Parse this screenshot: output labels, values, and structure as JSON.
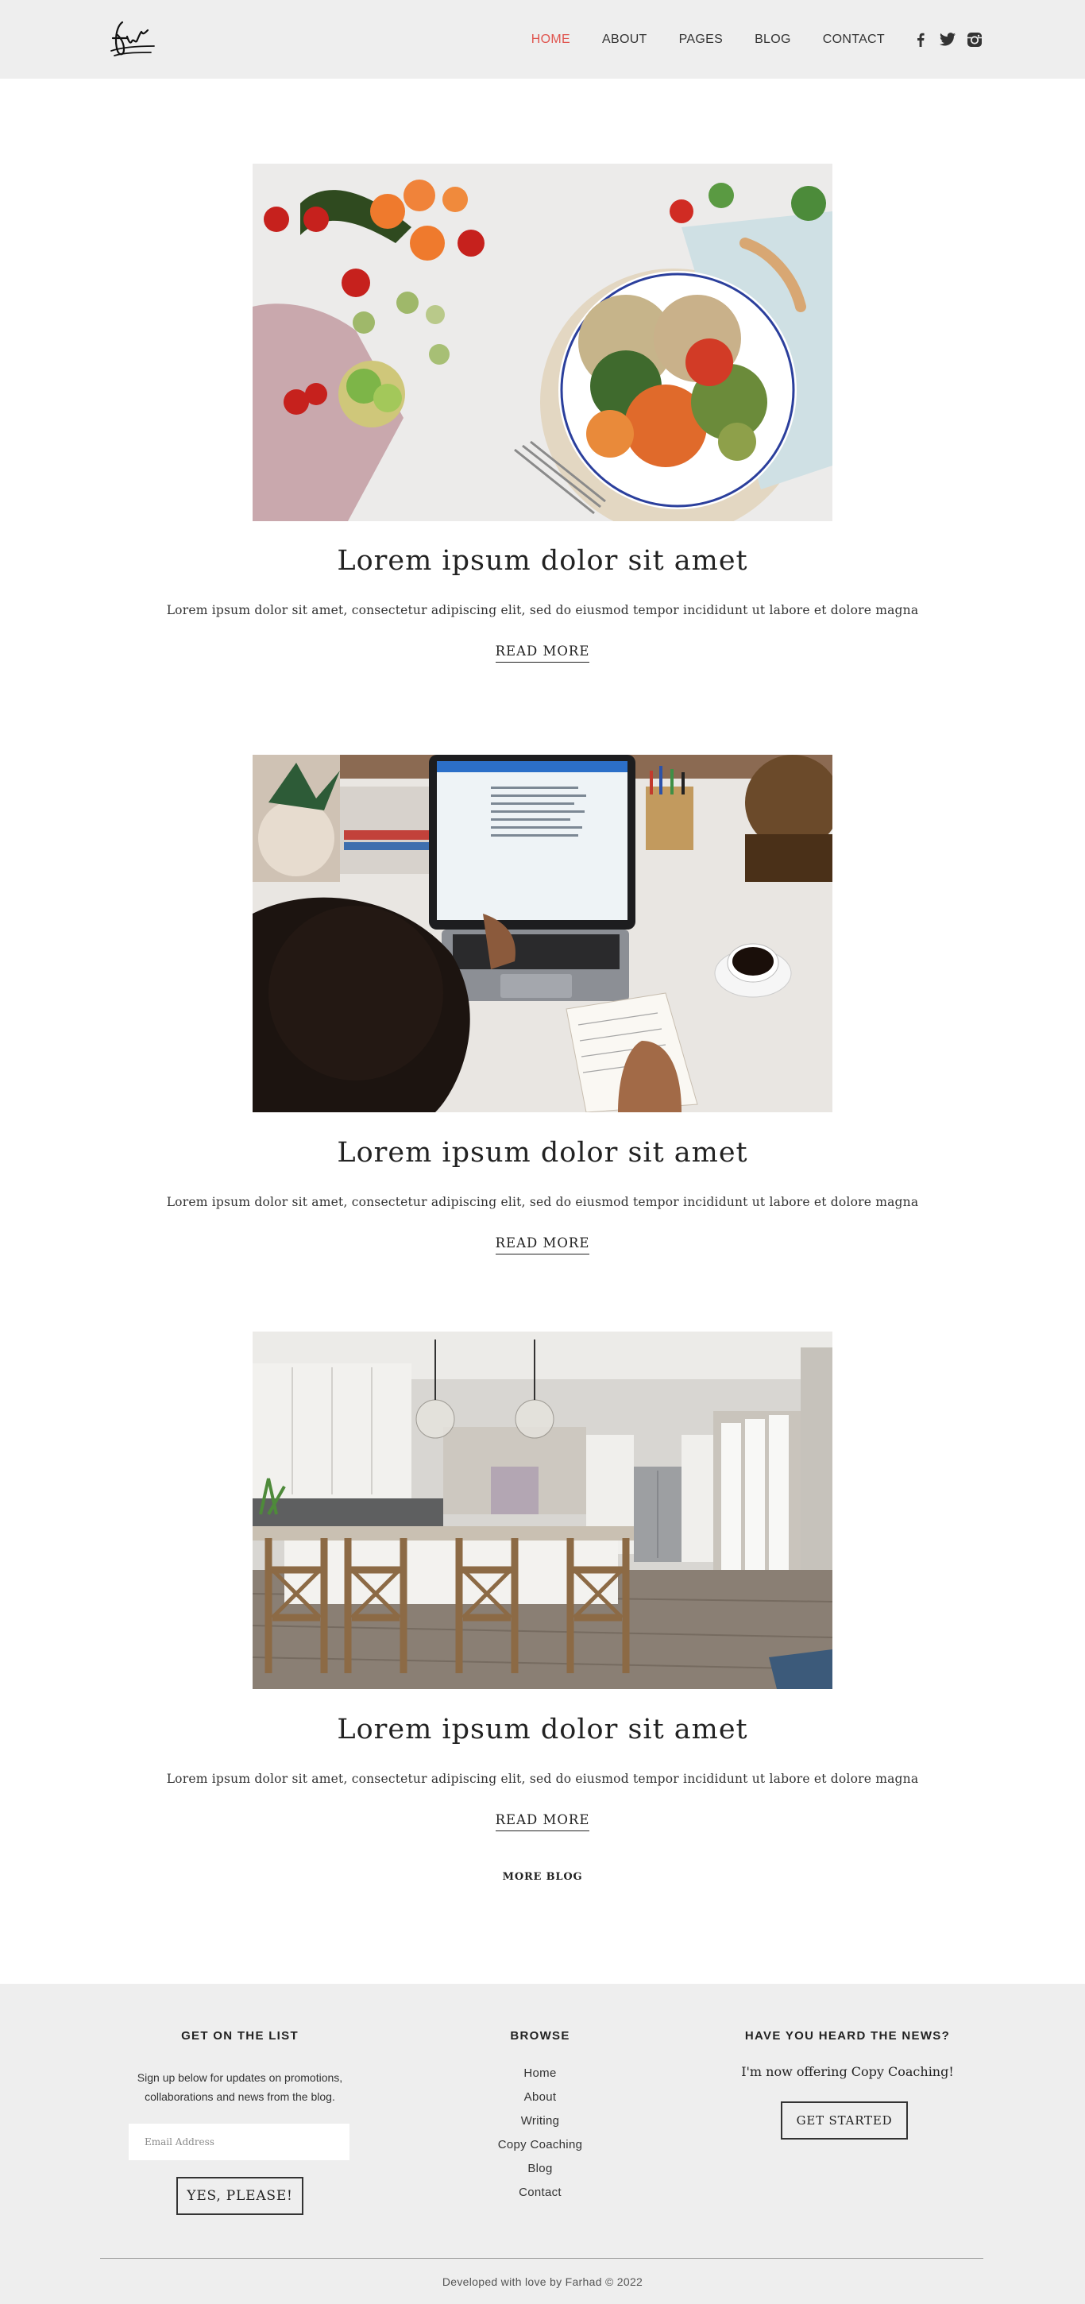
{
  "header": {
    "logo_alt": "fw",
    "nav": [
      {
        "label": "HOME",
        "active": true
      },
      {
        "label": "ABOUT",
        "active": false
      },
      {
        "label": "PAGES",
        "active": false
      },
      {
        "label": "BLOG",
        "active": false
      },
      {
        "label": "CONTACT",
        "active": false
      }
    ],
    "social_icons": [
      "facebook-icon",
      "twitter-icon",
      "instagram-icon"
    ],
    "active_color": "#e0554f"
  },
  "posts": [
    {
      "image": "food-bowl-photo",
      "title": "Lorem ipsum dolor sit amet",
      "excerpt": "Lorem ipsum dolor sit amet, consectetur adipiscing elit, sed do eiusmod tempor incididunt ut labore et dolore magna",
      "read_more": "READ MORE"
    },
    {
      "image": "laptop-desk-photo",
      "title": "Lorem ipsum dolor sit amet",
      "excerpt": "Lorem ipsum dolor sit amet, consectetur adipiscing elit, sed do eiusmod tempor incididunt ut labore et dolore magna",
      "read_more": "READ MORE"
    },
    {
      "image": "kitchen-interior-photo",
      "title": "Lorem ipsum dolor sit amet",
      "excerpt": "Lorem ipsum dolor sit amet, consectetur adipiscing elit, sed do eiusmod tempor incididunt ut labore et dolore magna",
      "read_more": "READ MORE"
    }
  ],
  "more_blog": "MORE BLOG",
  "footer": {
    "list": {
      "heading": "GET ON THE LIST",
      "text": "Sign up below for updates on promotions, collaborations and news from the blog.",
      "email_placeholder": "Email Address",
      "button": "YES, PLEASE!"
    },
    "browse": {
      "heading": "BROWSE",
      "items": [
        "Home",
        "About",
        "Writing",
        "Copy Coaching",
        "Blog",
        "Contact"
      ]
    },
    "news": {
      "heading": "HAVE YOU HEARD THE NEWS?",
      "text": "I'm now offering Copy Coaching!",
      "button": "GET STARTED"
    },
    "copyright": "Developed with love by Farhad © 2022"
  }
}
